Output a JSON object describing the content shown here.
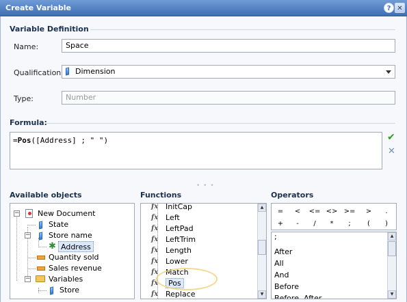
{
  "title": "Create Variable",
  "title_buttons": {
    "help": "?",
    "close": "✕"
  },
  "definition": {
    "section": "Variable Definition",
    "name_label": "Name:",
    "name_value": "Space",
    "qual_label": "Qualification:",
    "qual_value": "Dimension",
    "type_label": "Type:",
    "type_placeholder": "Number"
  },
  "formula": {
    "label": "Formula:",
    "fn": "Pos",
    "rest": "([Address] ; \" \")",
    "prefix": "="
  },
  "objects": {
    "label": "Available objects",
    "items": [
      {
        "label": "New Document",
        "icon": "document-icon"
      },
      {
        "label": "State",
        "icon": "dimension-icon"
      },
      {
        "label": "Store name",
        "icon": "dimension-icon"
      },
      {
        "label": "Address",
        "icon": "detail-icon"
      },
      {
        "label": "Quantity sold",
        "icon": "measure-icon"
      },
      {
        "label": "Sales revenue",
        "icon": "measure-icon"
      },
      {
        "label": "Variables",
        "icon": "folder-icon"
      },
      {
        "label": "Store",
        "icon": "dimension-icon"
      }
    ]
  },
  "functions": {
    "label": "Functions",
    "items": [
      "InitCap",
      "Left",
      "LeftPad",
      "LeftTrim",
      "Length",
      "Lower",
      "Match",
      "Pos",
      "Replace"
    ]
  },
  "operators": {
    "label": "Operators",
    "grid": [
      "=",
      "<",
      "<=",
      "<>",
      ">=",
      ">",
      ".",
      "+",
      "-",
      "/",
      "*",
      ";",
      "(",
      ")"
    ],
    "list": [
      ";",
      "After",
      "All",
      "And",
      "Before",
      "Before, After"
    ]
  }
}
